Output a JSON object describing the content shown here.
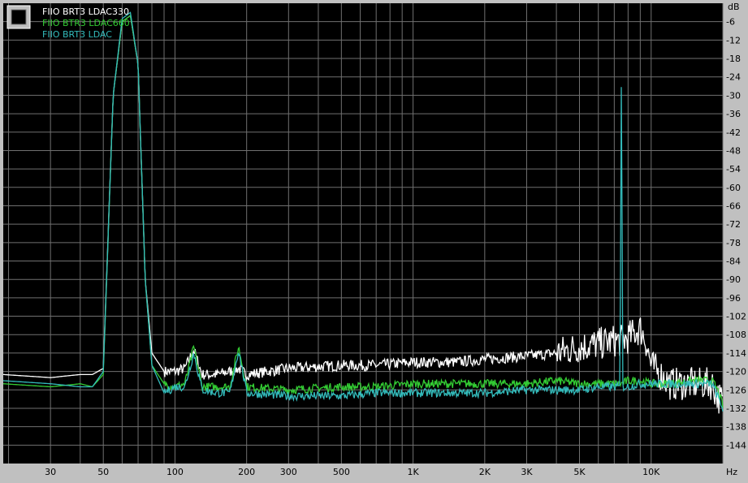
{
  "chart_data": {
    "type": "line",
    "ylabel": "dB",
    "xlabel": "Hz",
    "x_scale": "log",
    "xlim": [
      19,
      20000
    ],
    "ylim": [
      -150,
      0
    ],
    "grid": true,
    "legend_position": "top-left",
    "y_ticks": [
      -6,
      -12,
      -18,
      -24,
      -30,
      -36,
      -42,
      -48,
      -54,
      -60,
      -66,
      -72,
      -78,
      -84,
      -90,
      -96,
      -102,
      -108,
      -114,
      -120,
      -126,
      -132,
      -138,
      -144
    ],
    "x_ticks": [
      {
        "v": 30,
        "label": "30"
      },
      {
        "v": 50,
        "label": "50"
      },
      {
        "v": 100,
        "label": "100"
      },
      {
        "v": 200,
        "label": "200"
      },
      {
        "v": 300,
        "label": "300"
      },
      {
        "v": 500,
        "label": "500"
      },
      {
        "v": 1000,
        "label": "1K"
      },
      {
        "v": 2000,
        "label": "2K"
      },
      {
        "v": 3000,
        "label": "3K"
      },
      {
        "v": 5000,
        "label": "5K"
      },
      {
        "v": 10000,
        "label": "10K"
      }
    ],
    "x_grid": [
      20,
      30,
      40,
      50,
      60,
      70,
      80,
      90,
      100,
      200,
      300,
      400,
      500,
      600,
      700,
      800,
      900,
      1000,
      2000,
      3000,
      4000,
      5000,
      6000,
      7000,
      8000,
      9000,
      10000,
      20000
    ],
    "series": [
      {
        "name": "FIIO BRT3 LDAC330",
        "color": "#ffffff",
        "noise": 1.8,
        "x": [
          19,
          30,
          40,
          45,
          50,
          55,
          60,
          65,
          70,
          75,
          80,
          90,
          100,
          110,
          120,
          130,
          150,
          170,
          185,
          200,
          300,
          500,
          700,
          1000,
          1500,
          2000,
          3000,
          4000,
          5000,
          6000,
          7000,
          7500,
          8000,
          9000,
          9500,
          10000,
          12000,
          15000,
          18000,
          19000,
          20000
        ],
        "y": [
          -121,
          -122,
          -121,
          -121,
          -119,
          -30,
          -6,
          -4,
          -20,
          -90,
          -114,
          -120,
          -120,
          -119,
          -113,
          -121,
          -121,
          -120,
          -119,
          -121,
          -119,
          -118,
          -118,
          -117,
          -117,
          -116,
          -115,
          -114,
          -112,
          -111,
          -110,
          -110,
          -109,
          -106,
          -110,
          -118,
          -124,
          -124,
          -124,
          -128,
          -130
        ]
      },
      {
        "name": "FIIO BTR3 LDAC660",
        "color": "#33cc33",
        "noise": 1.4,
        "x": [
          19,
          30,
          40,
          45,
          50,
          55,
          60,
          65,
          70,
          75,
          80,
          90,
          100,
          110,
          120,
          130,
          150,
          170,
          185,
          200,
          300,
          500,
          700,
          1000,
          1500,
          2000,
          3000,
          4000,
          5000,
          6000,
          7000,
          7500,
          8000,
          9000,
          10000,
          12000,
          15000,
          18000,
          19000,
          20000
        ],
        "y": [
          -124,
          -125,
          -124,
          -125,
          -121,
          -30,
          -6,
          -4,
          -20,
          -90,
          -118,
          -124,
          -125,
          -124,
          -112,
          -125,
          -125,
          -125,
          -112,
          -125,
          -126,
          -125,
          -125,
          -124,
          -124,
          -124,
          -124,
          -123,
          -124,
          -124,
          -124,
          -124,
          -123,
          -123,
          -124,
          -124,
          -123,
          -123,
          -126,
          -131
        ]
      },
      {
        "name": "FIIO BRT3 LDAC",
        "color": "#33bbbb",
        "noise": 1.4,
        "x": [
          19,
          30,
          40,
          45,
          50,
          55,
          60,
          65,
          70,
          75,
          80,
          90,
          100,
          110,
          120,
          130,
          150,
          170,
          185,
          200,
          300,
          500,
          700,
          1000,
          1500,
          2000,
          3000,
          4000,
          5000,
          6000,
          7000,
          7400,
          7500,
          7600,
          8000,
          9000,
          10000,
          12000,
          15000,
          18000,
          19000,
          20000
        ],
        "y": [
          -123,
          -124,
          -125,
          -125,
          -120,
          -30,
          -5,
          -3,
          -20,
          -90,
          -118,
          -127,
          -125,
          -125,
          -114,
          -126,
          -127,
          -127,
          -113,
          -127,
          -128,
          -128,
          -127,
          -127,
          -127,
          -127,
          -126,
          -126,
          -126,
          -125,
          -125,
          -125,
          -18,
          -125,
          -125,
          -124,
          -124,
          -124,
          -124,
          -124,
          -128,
          -132
        ]
      }
    ]
  }
}
